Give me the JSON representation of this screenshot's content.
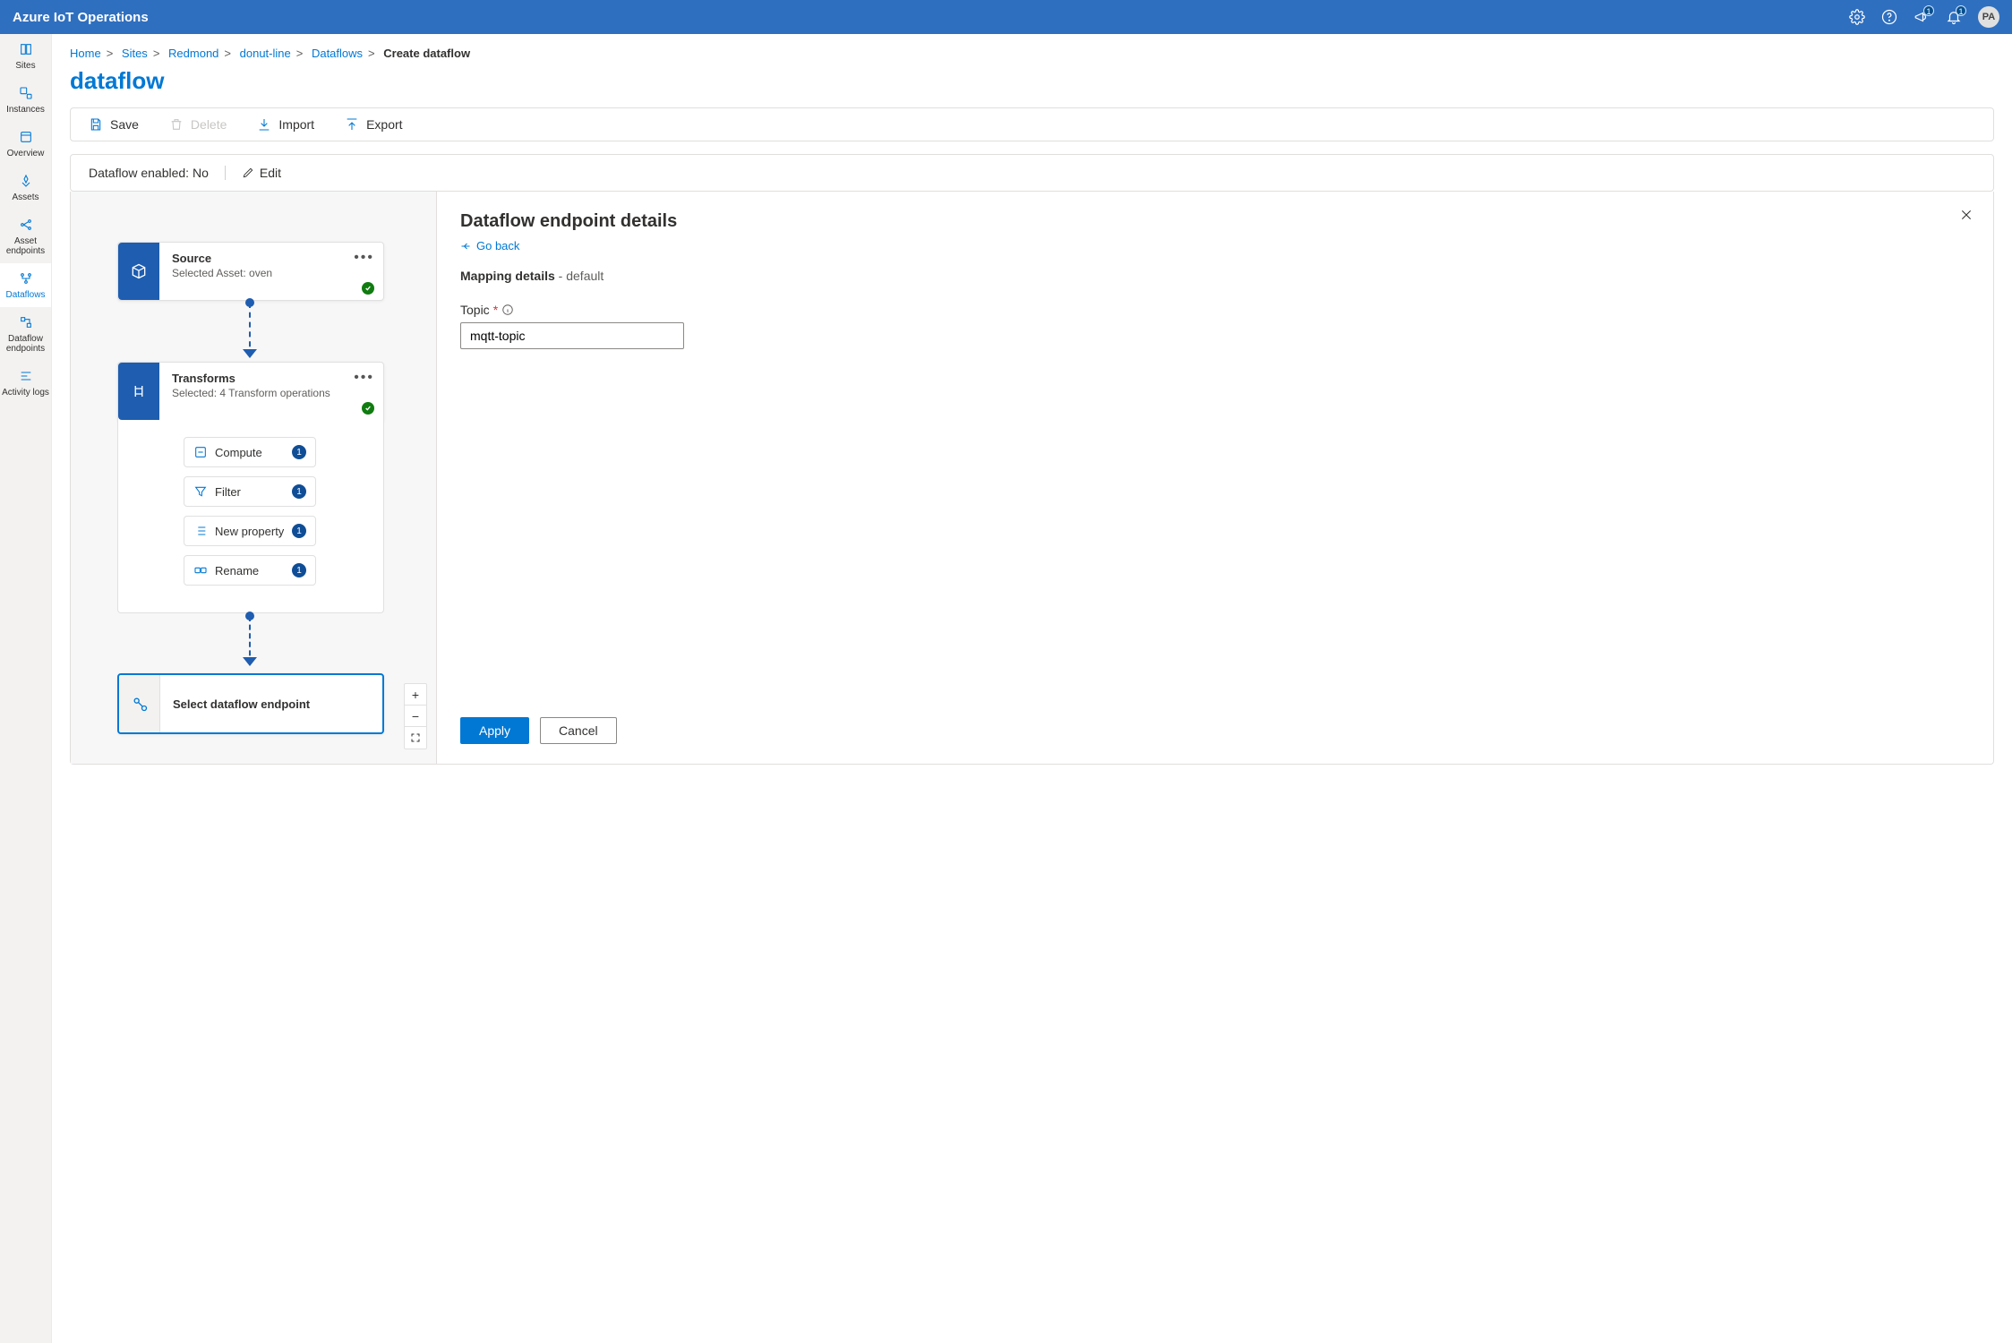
{
  "app_title": "Azure IoT Operations",
  "user_initials": "PA",
  "notif_badge_1": "1",
  "notif_badge_2": "1",
  "nav": [
    {
      "icon": "sites",
      "label": "Sites"
    },
    {
      "icon": "instances",
      "label": "Instances"
    },
    {
      "icon": "overview",
      "label": "Overview"
    },
    {
      "icon": "assets",
      "label": "Assets"
    },
    {
      "icon": "asset-endpoints",
      "label": "Asset endpoints"
    },
    {
      "icon": "dataflows",
      "label": "Dataflows"
    },
    {
      "icon": "dataflow-endpoints",
      "label": "Dataflow endpoints"
    },
    {
      "icon": "activity-logs",
      "label": "Activity logs"
    }
  ],
  "nav_active_index": 5,
  "breadcrumb": {
    "items": [
      "Home",
      "Sites",
      "Redmond",
      "donut-line",
      "Dataflows"
    ],
    "current": "Create dataflow"
  },
  "page_title": "dataflow",
  "toolbar": {
    "save": "Save",
    "delete": "Delete",
    "import": "Import",
    "export": "Export"
  },
  "enabled_bar": {
    "label": "Dataflow enabled:",
    "value": "No",
    "edit": "Edit"
  },
  "graph": {
    "source": {
      "title": "Source",
      "sub": "Selected Asset: oven"
    },
    "transforms": {
      "title": "Transforms",
      "sub": "Selected: 4 Transform operations"
    },
    "children": [
      {
        "label": "Compute",
        "count": "1"
      },
      {
        "label": "Filter",
        "count": "1"
      },
      {
        "label": "New property",
        "count": "1"
      },
      {
        "label": "Rename",
        "count": "1"
      }
    ],
    "endpoint": {
      "title": "Select dataflow endpoint"
    }
  },
  "zoom": {
    "in": "+",
    "out": "−",
    "fit": "⤢"
  },
  "detail": {
    "heading": "Dataflow endpoint details",
    "go_back": "Go back",
    "mapping_prefix": "Mapping details",
    "mapping_suffix": " - default",
    "topic_label": "Topic",
    "topic_value": "mqtt-topic",
    "apply": "Apply",
    "cancel": "Cancel"
  }
}
